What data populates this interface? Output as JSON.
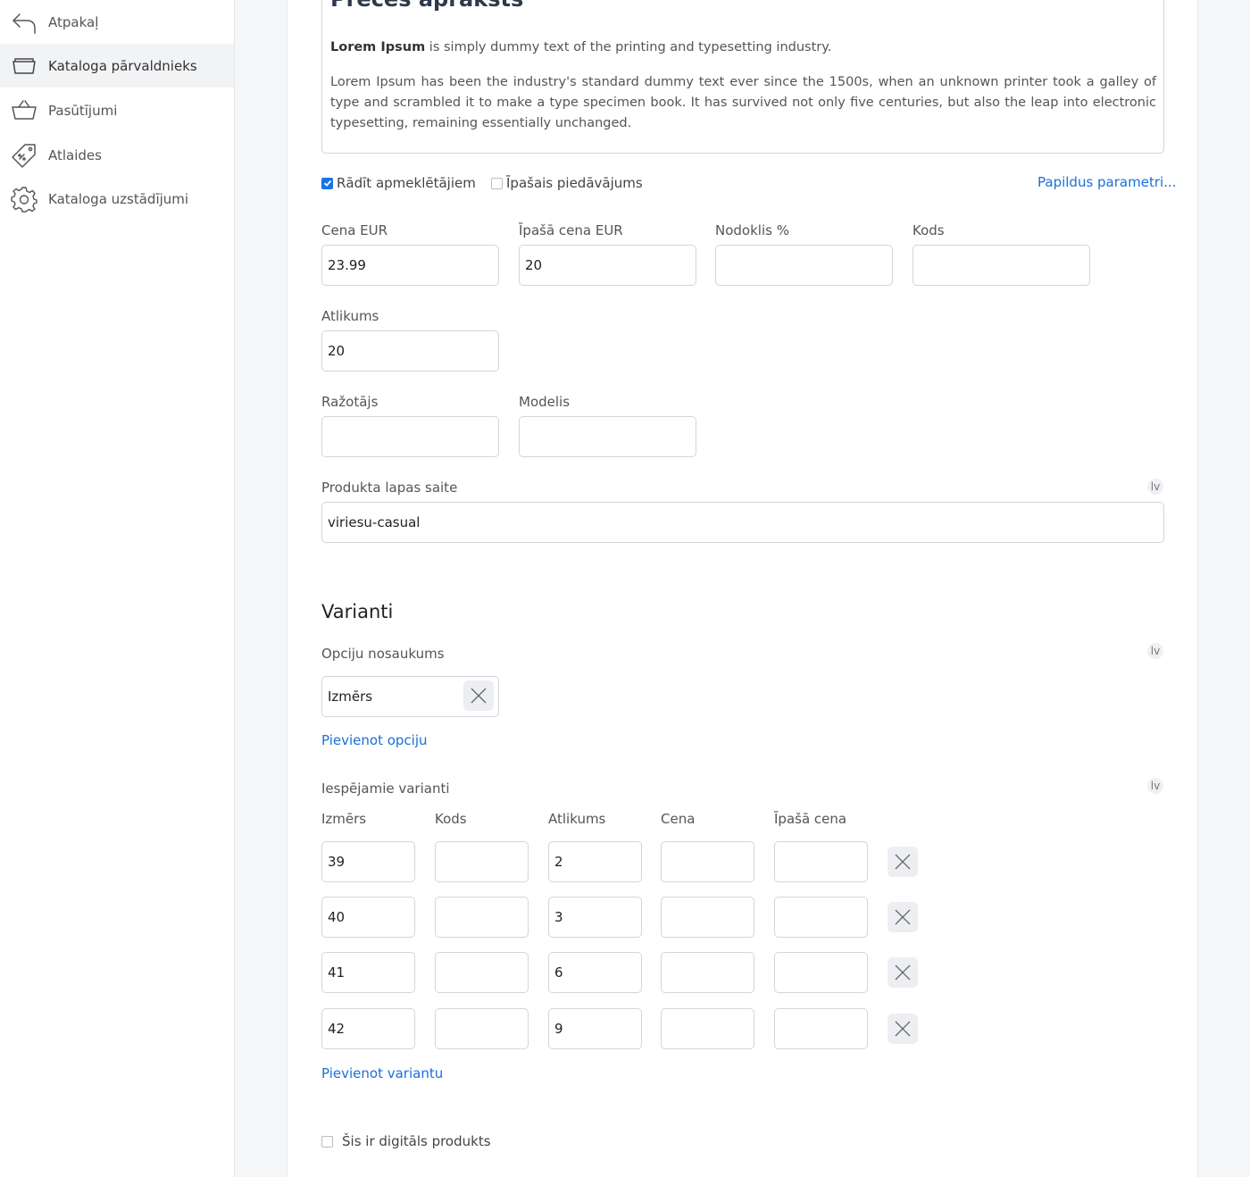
{
  "sidebar": {
    "items": [
      {
        "label": "Atpakaļ",
        "icon": "back-arrow-icon"
      },
      {
        "label": "Kataloga pārvaldnieks",
        "icon": "catalog-box-icon"
      },
      {
        "label": "Pasūtījumi",
        "icon": "basket-icon"
      },
      {
        "label": "Atlaides",
        "icon": "price-tag-icon"
      },
      {
        "label": "Kataloga uzstādījumi",
        "icon": "gear-icon"
      }
    ]
  },
  "description": {
    "title": "Preces apraksts",
    "p1_bold": "Lorem Ipsum",
    "p1_rest": " is simply dummy text of the printing and typesetting industry.",
    "p2": "Lorem Ipsum has been the industry's standard dummy text ever since the 1500s, when an unknown printer took a galley of type and scrambled it to make a type specimen book. It has survived not only five centuries, but also the leap into electronic typesetting, remaining essentially unchanged."
  },
  "options": {
    "show_visitors_label": "Rādīt apmeklētājiem",
    "show_visitors_checked": true,
    "special_offer_label": "Īpašais piedāvājums",
    "special_offer_checked": false,
    "extra_params_link": "Papildus parametri..."
  },
  "fields": {
    "price_label": "Cena EUR",
    "price_value": "23.99",
    "special_price_label": "Īpašā cena EUR",
    "special_price_value": "20",
    "tax_label": "Nodoklis %",
    "tax_value": "",
    "code_label": "Kods",
    "code_value": "",
    "stock_label": "Atlikums",
    "stock_value": "20",
    "manufacturer_label": "Ražotājs",
    "manufacturer_value": "",
    "model_label": "Modelis",
    "model_value": "",
    "url_label": "Produkta lapas saite",
    "url_value": "viriesu-casual",
    "lang": "lv"
  },
  "variants": {
    "section_title": "Varianti",
    "option_name_label": "Opciju nosaukums",
    "option_name_value": "Izmērs",
    "add_option_link": "Pievienot opciju",
    "possible_label": "Iespējamie varianti",
    "lang": "lv",
    "columns": [
      "Izmērs",
      "Kods",
      "Atlikums",
      "Cena",
      "Īpašā cena"
    ],
    "rows": [
      {
        "size": "39",
        "code": "",
        "stock": "2",
        "price": "",
        "special": ""
      },
      {
        "size": "40",
        "code": "",
        "stock": "3",
        "price": "",
        "special": ""
      },
      {
        "size": "41",
        "code": "",
        "stock": "6",
        "price": "",
        "special": ""
      },
      {
        "size": "42",
        "code": "",
        "stock": "9",
        "price": "",
        "special": ""
      }
    ],
    "add_variant_link": "Pievienot variantu"
  },
  "digital": {
    "label": "Šis ir digitāls produkts",
    "checked": false
  },
  "colors": {
    "accent": "#1a6fd8",
    "sidebar_active": "#f2f3f5"
  }
}
